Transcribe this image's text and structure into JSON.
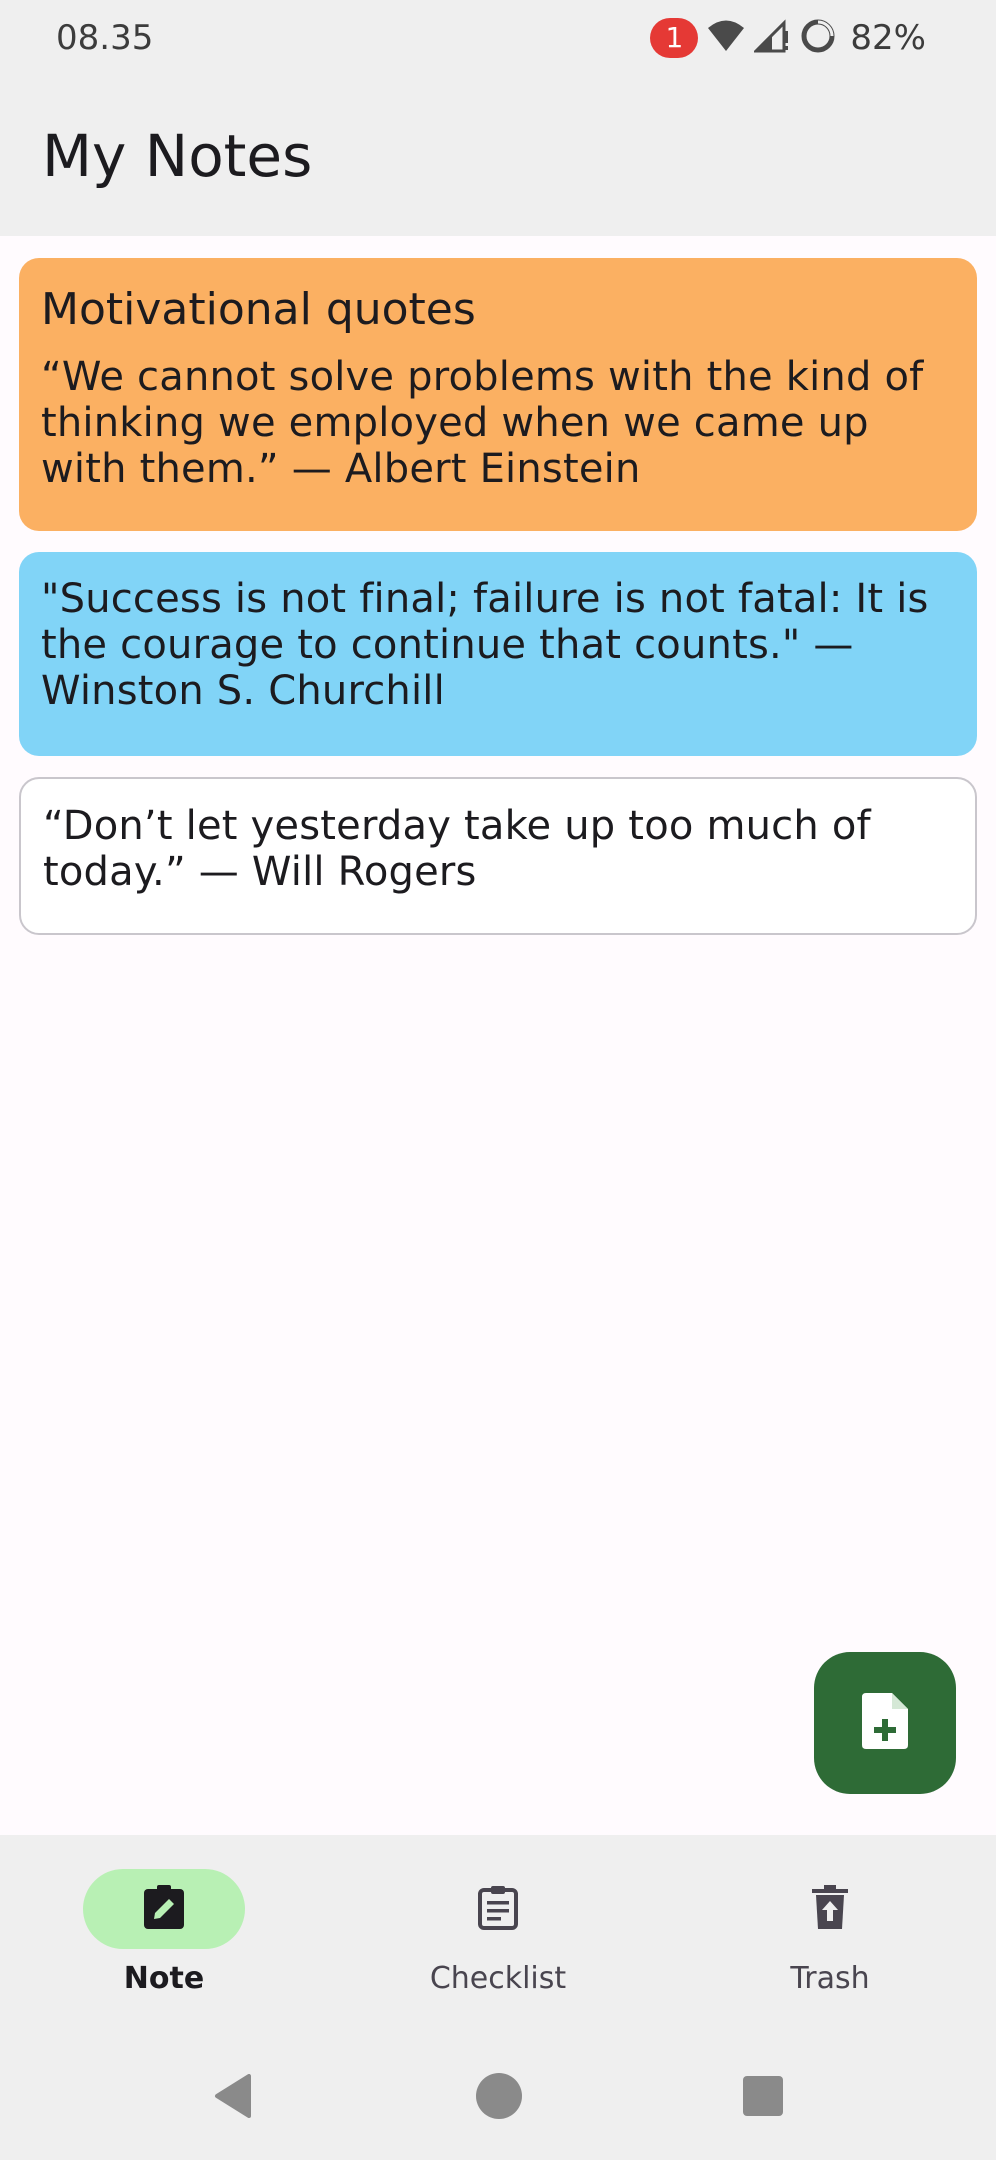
{
  "status_bar": {
    "time": "08.35",
    "notification_count": "1",
    "battery_percent": "82%"
  },
  "app_bar": {
    "title": "My Notes"
  },
  "notes": [
    {
      "title": "Motivational quotes",
      "body": "“We cannot solve problems with the kind of thinking we employed when we came up with them.” — Albert Einstein",
      "color": "#FBB062"
    },
    {
      "title": "",
      "body": "\"Success is not final; failure is not fatal: It is the courage to continue that counts.\" — Winston S. Churchill",
      "color": "#81D4F7"
    },
    {
      "title": "",
      "body": "“Don’t let yesterday take up too much of today.” — Will Rogers",
      "color": "#FFFFFF"
    }
  ],
  "fab": {
    "icon": "add-note-icon",
    "color": "#2E6B36"
  },
  "bottom_nav": {
    "items": [
      {
        "label": "Note",
        "icon": "edit-note-icon",
        "active": true
      },
      {
        "label": "Checklist",
        "icon": "checklist-icon",
        "active": false
      },
      {
        "label": "Trash",
        "icon": "trash-icon",
        "active": false
      }
    ],
    "active_indicator_color": "#B8F0B4"
  },
  "system_nav": {
    "buttons": [
      "back-icon",
      "home-icon",
      "recents-icon"
    ]
  }
}
